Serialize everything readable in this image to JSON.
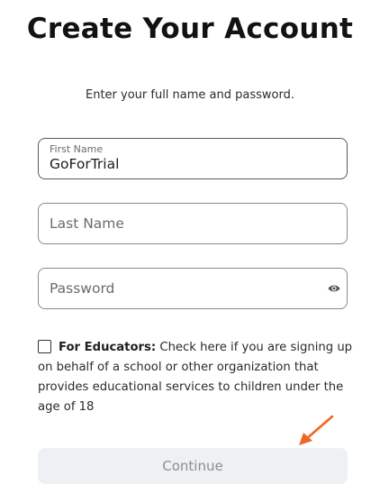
{
  "header": {
    "title": "Create Your Account",
    "subtitle": "Enter your full name and password."
  },
  "form": {
    "first_name": {
      "label": "First Name",
      "value": "GoForTrial"
    },
    "last_name": {
      "placeholder": "Last Name"
    },
    "password": {
      "placeholder": "Password",
      "toggle_icon": "eye-icon"
    },
    "educator": {
      "checked": false,
      "bold_label": "For Educators:",
      "text": " Check here if you are signing up on behalf of a school or other organization that provides educational services to children under the age of 18"
    },
    "continue_label": "Continue"
  },
  "annotation": {
    "arrow_icon": "arrow-icon",
    "color": "#f26522"
  },
  "colors": {
    "button_bg": "#eef1f3",
    "button_text": "#8c8c8c"
  }
}
